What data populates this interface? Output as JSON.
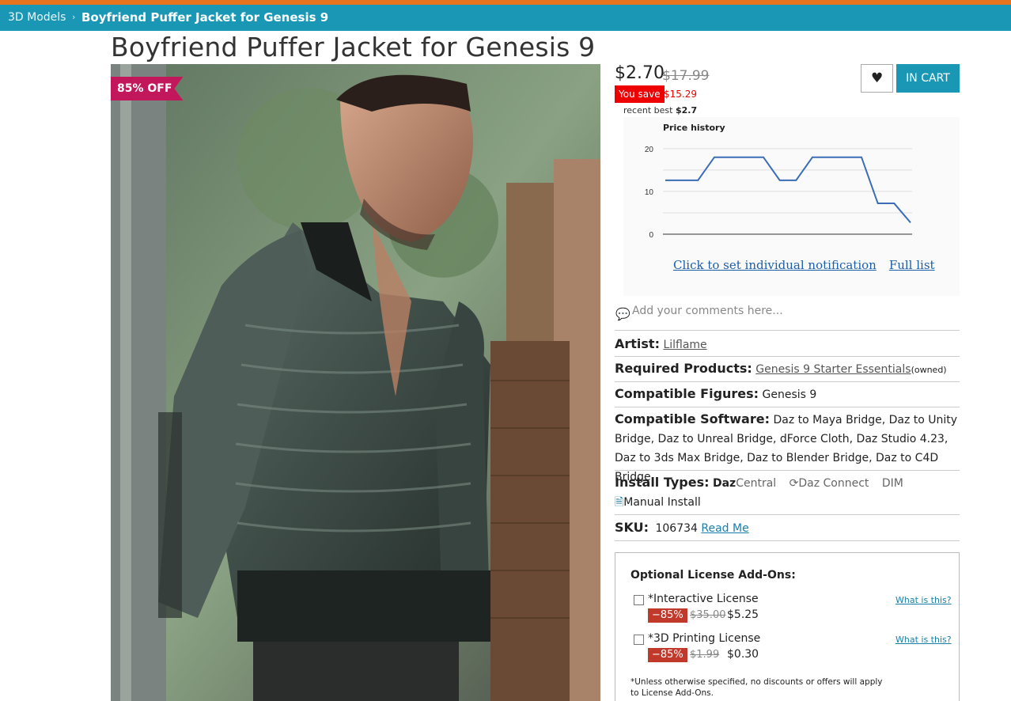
{
  "breadcrumb": {
    "parent": "3D Models",
    "separator": "›",
    "current": "Boyfriend Puffer Jacket for Genesis 9"
  },
  "product": {
    "title": "Boyfriend Puffer Jacket for Genesis 9",
    "discount_badge": "85% OFF",
    "image_icon": "product-render-image"
  },
  "pricing": {
    "price": "$2.70",
    "original_price": "$17.99",
    "you_save_label": "You save",
    "you_save_amount": "$15.29",
    "recent_best_label": "recent best",
    "recent_best_value": "$2.7"
  },
  "actions": {
    "wishlist_icon": "heart-icon",
    "cart_label": "IN CART"
  },
  "price_chart": {
    "notify_link": "Click to set individual notification",
    "full_list_link": "Full list"
  },
  "chart_data": {
    "type": "line",
    "title": "Price history",
    "xlabel": "",
    "ylabel": "",
    "ylim": [
      0,
      22
    ],
    "yticks": [
      "0",
      "10",
      "20"
    ],
    "grid": true,
    "series": [
      {
        "values": [
          12.6,
          12.6,
          12.6,
          17.99,
          17.99,
          17.99,
          17.99,
          12.6,
          12.6,
          17.99,
          17.99,
          17.99,
          17.99,
          7.2,
          7.2,
          2.7
        ]
      }
    ],
    "color": "#3a6db5"
  },
  "comments": {
    "icon": "comment-icon",
    "placeholder": "Add your comments here..."
  },
  "details": {
    "artist_label": "Artist:",
    "artist": "Lilflame",
    "required_label": "Required Products:",
    "required": "Genesis 9 Starter Essentials",
    "required_owned": "(owned)",
    "figures_label": "Compatible Figures:",
    "figures": "Genesis 9",
    "software_label": "Compatible Software:",
    "software": "Daz to Maya Bridge, Daz to Unity Bridge, Daz to Unreal Bridge, dForce Cloth, Daz Studio 4.23, Daz to 3ds Max Bridge, Daz to Blender Bridge, Daz to C4D Bridge",
    "install_label": "Install Types:",
    "install_daz": "Daz",
    "install_central": "Central",
    "install_connect": "Daz Connect",
    "install_dim": "DIM",
    "install_manual": "Manual Install",
    "sku_label": "SKU:",
    "sku": "106734",
    "readme": "Read Me"
  },
  "addons": {
    "title": "Optional License Add-Ons:",
    "items": [
      {
        "name": "*Interactive License",
        "pct": "−85%",
        "was": "$35.00",
        "now": "$5.25",
        "help": "What is this?"
      },
      {
        "name": "*3D Printing License",
        "pct": "−85%",
        "was": "$1.99",
        "now": "$0.30",
        "help": "What is this?"
      }
    ],
    "note": "*Unless otherwise specified, no discounts or offers will apply to License Add-Ons."
  },
  "colors": {
    "accent": "#1a97b4",
    "top_strip": "#e8731f",
    "badge": "#c2185b",
    "save": "#ee0000"
  }
}
